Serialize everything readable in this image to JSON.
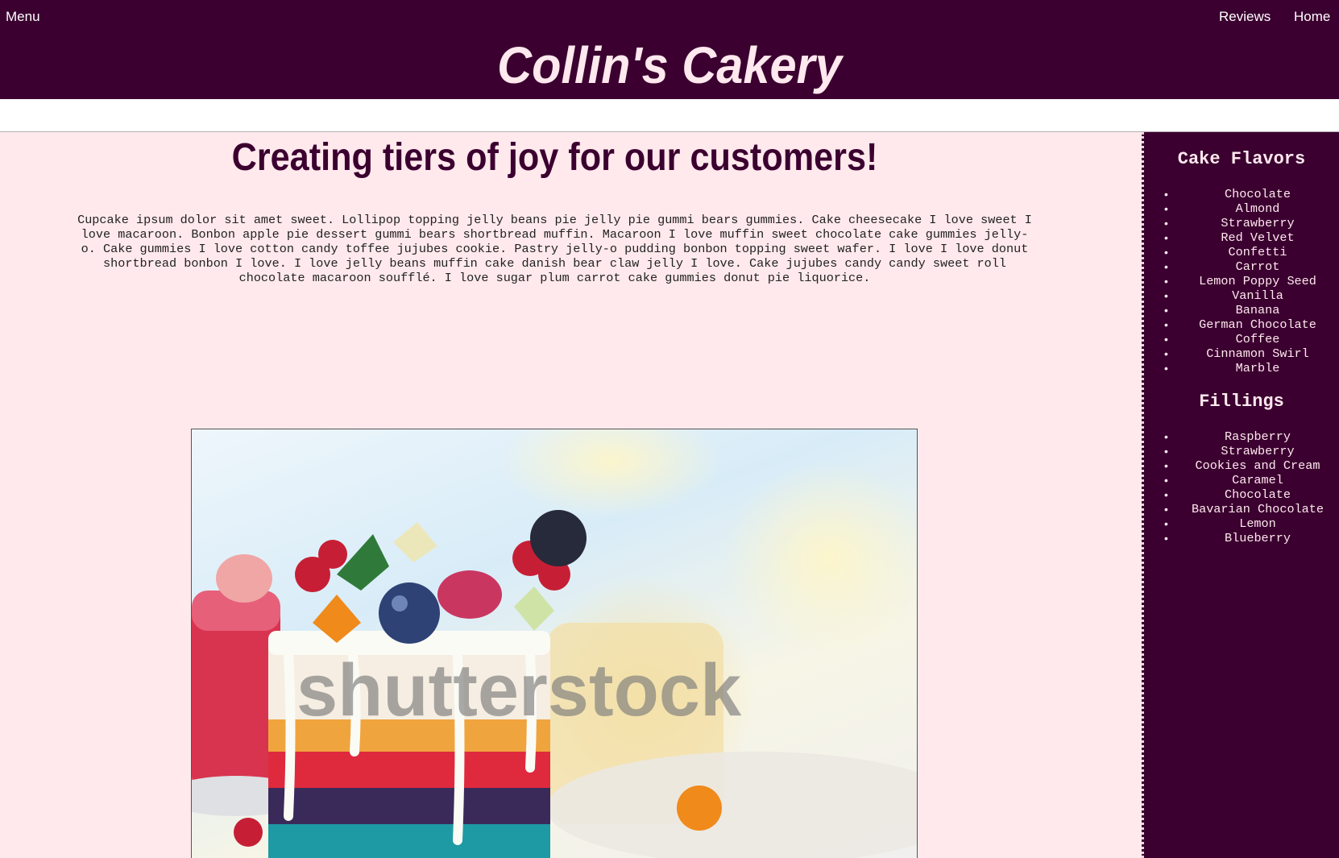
{
  "nav": {
    "menu": "Menu",
    "reviews": "Reviews",
    "home": "Home"
  },
  "site_title": "Collin's Cakery",
  "headline": "Creating tiers of joy for our customers!",
  "intro": "Cupcake ipsum dolor sit amet sweet. Lollipop topping jelly beans pie jelly pie gummi bears gummies. Cake cheesecake I love sweet I love macaroon. Bonbon apple pie dessert gummi bears shortbread muffin. Macaroon I love muffin sweet chocolate cake gummies jelly-o. Cake gummies I love cotton candy toffee jujubes cookie. Pastry jelly-o pudding bonbon topping sweet wafer. I love I love donut shortbread bonbon I love. I love jelly beans muffin cake danish bear claw jelly I love. Cake jujubes candy candy sweet roll chocolate macaroon soufflé. I love sugar plum carrot cake gummies donut pie liquorice.",
  "photo": {
    "watermark": "shutterstock",
    "subject": "rainbow-layer-cake-slice"
  },
  "sidebar": {
    "flavors_title": "Cake Flavors",
    "flavors": [
      "Chocolate",
      "Almond",
      "Strawberry",
      "Red Velvet",
      "Confetti",
      "Carrot",
      "Lemon Poppy Seed",
      "Vanilla",
      "Banana",
      "German Chocolate",
      "Coffee",
      "Cinnamon Swirl",
      "Marble"
    ],
    "fillings_title": "Fillings",
    "fillings": [
      "Raspberry",
      "Strawberry",
      "Cookies and Cream",
      "Caramel",
      "Chocolate",
      "Bavarian Chocolate",
      "Lemon",
      "Blueberry"
    ]
  },
  "colors": {
    "header_bg": "#3b0030",
    "page_bg": "#ffe9ec",
    "title_text": "#ffe8ee",
    "headline_text": "#3b0030"
  }
}
